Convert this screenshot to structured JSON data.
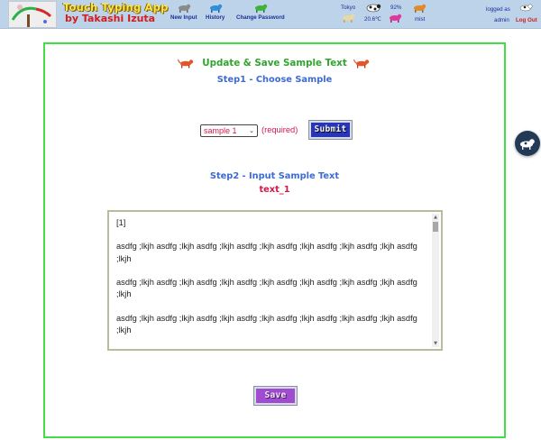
{
  "header": {
    "app_title": "Touch Typing App",
    "app_author": "by Takashi Izuta",
    "nav": [
      {
        "label": "New Input"
      },
      {
        "label": "History"
      },
      {
        "label": "Change Password"
      }
    ],
    "weather": {
      "city": "Tokyo",
      "humidity": "92%",
      "temperature": "20.6℃",
      "condition": "mist"
    },
    "login": {
      "status": "logged as",
      "user": "admin",
      "logout": "Log Out"
    }
  },
  "page": {
    "title": "Update & Save Sample Text",
    "step1": "Step1 - Choose Sample",
    "select_value": "sample 1",
    "required": "(required)",
    "submit": "Submit",
    "step2": "Step2 - Input Sample Text",
    "text_name": "text_1",
    "text_lines": [
      "[1]",
      "asdfg ;lkjh asdfg ;lkjh asdfg ;lkjh asdfg ;lkjh asdfg ;lkjh asdfg ;lkjh asdfg ;lkjh asdfg ;lkjh",
      "asdfg ;lkjh asdfg ;lkjh asdfg ;lkjh asdfg ;lkjh asdfg ;lkjh asdfg ;lkjh asdfg ;lkjh asdfg ;lkjh",
      "asdfg ;lkjh asdfg ;lkjh asdfg ;lkjh asdfg ;lkjh asdfg ;lkjh asdfg ;lkjh asdfg ;lkjh asdfg ;lkjh"
    ],
    "save": "Save"
  },
  "colors": {
    "header_bg": "#bcd3ea",
    "card_border": "#44dd44",
    "title_green": "#2fa52f",
    "step_blue": "#3d6ad3",
    "accent_red": "#d4174d"
  }
}
